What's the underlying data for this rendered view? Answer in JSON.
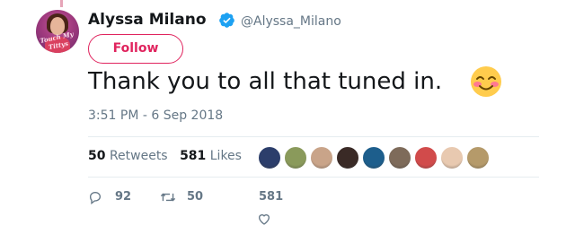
{
  "tweet": {
    "author_name": "Alyssa Milano",
    "author_handle": "@Alyssa_Milano",
    "avatar_caption": "Touch My Tittys",
    "follow_label": "Follow",
    "text": "Thank you to all that tuned in.",
    "emoji": "smiling-face-with-blushing-cheeks",
    "timestamp": "3:51 PM - 6 Sep 2018"
  },
  "stats": {
    "retweets_count": "50",
    "retweets_label": "Retweets",
    "likes_count": "581",
    "likes_label": "Likes"
  },
  "likers": [
    {
      "color": "#2c3e6b"
    },
    {
      "color": "#8a9a5b"
    },
    {
      "color": "#c9a489"
    },
    {
      "color": "#3a2a26"
    },
    {
      "color": "#1d5e8c"
    },
    {
      "color": "#7e6b5a"
    },
    {
      "color": "#d14b4b"
    },
    {
      "color": "#e8c9b0"
    },
    {
      "color": "#b59a6a"
    }
  ],
  "actions": {
    "reply_count": "92",
    "retweet_count": "50",
    "like_count": "581"
  },
  "colors": {
    "accent": "#e0245e",
    "verified": "#1da1f2",
    "muted": "#657786"
  }
}
